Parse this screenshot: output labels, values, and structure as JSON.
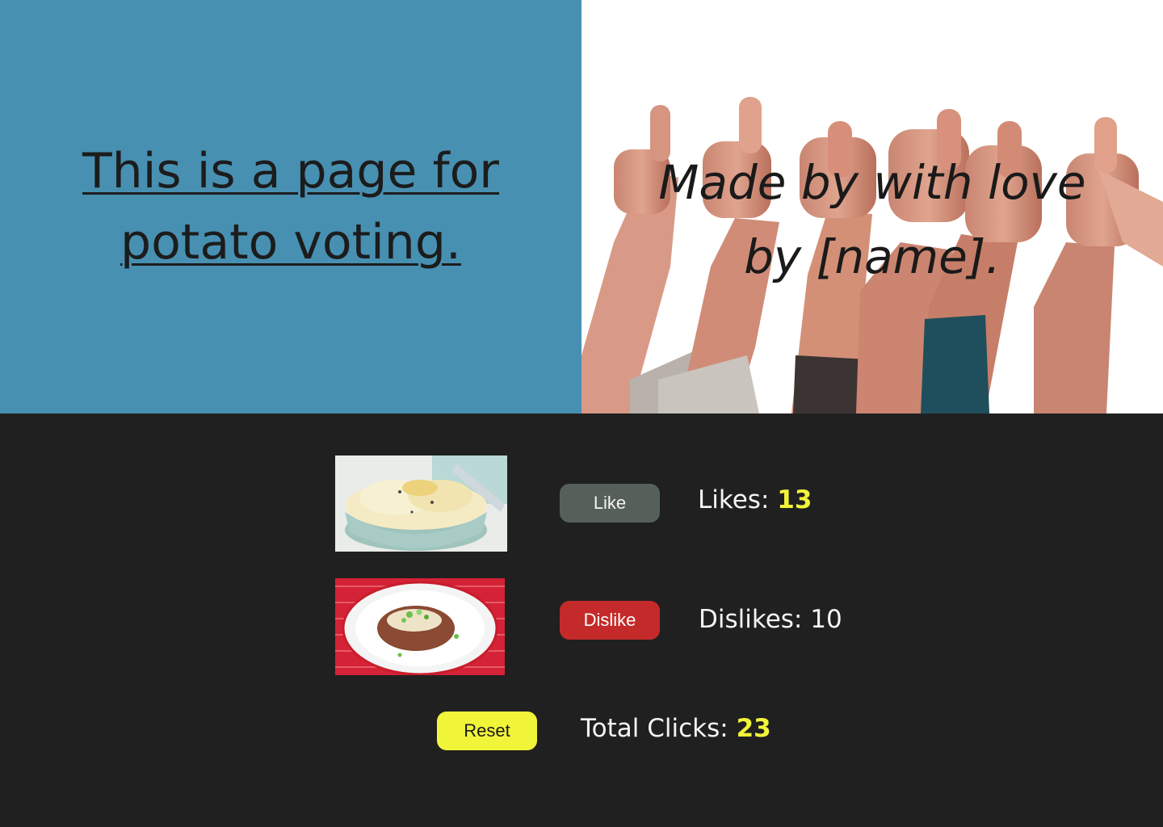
{
  "hero": {
    "headline_line1": "This is a page for",
    "headline_line2": "potato voting.",
    "credit_line1": "Made by with love",
    "credit_line2": "by [name]."
  },
  "voting": {
    "like_label": "Like",
    "dislike_label": "Dislike",
    "reset_label": "Reset",
    "likes_label": "Likes:",
    "likes_count": "13",
    "dislikes_label": "Dislikes:",
    "dislikes_count": "10",
    "total_label": "Total Clicks:",
    "total_count": "23"
  },
  "images": {
    "hands": "thumbs-up-hands-photo",
    "potato_1": "mashed-potato-photo",
    "potato_2": "baked-potato-photo"
  },
  "colors": {
    "left_panel": "#4790b2",
    "background": "#202020",
    "like": "#56605a",
    "dislike": "#c52a2a",
    "reset": "#f1f53a",
    "highlight": "#f1f53a"
  }
}
